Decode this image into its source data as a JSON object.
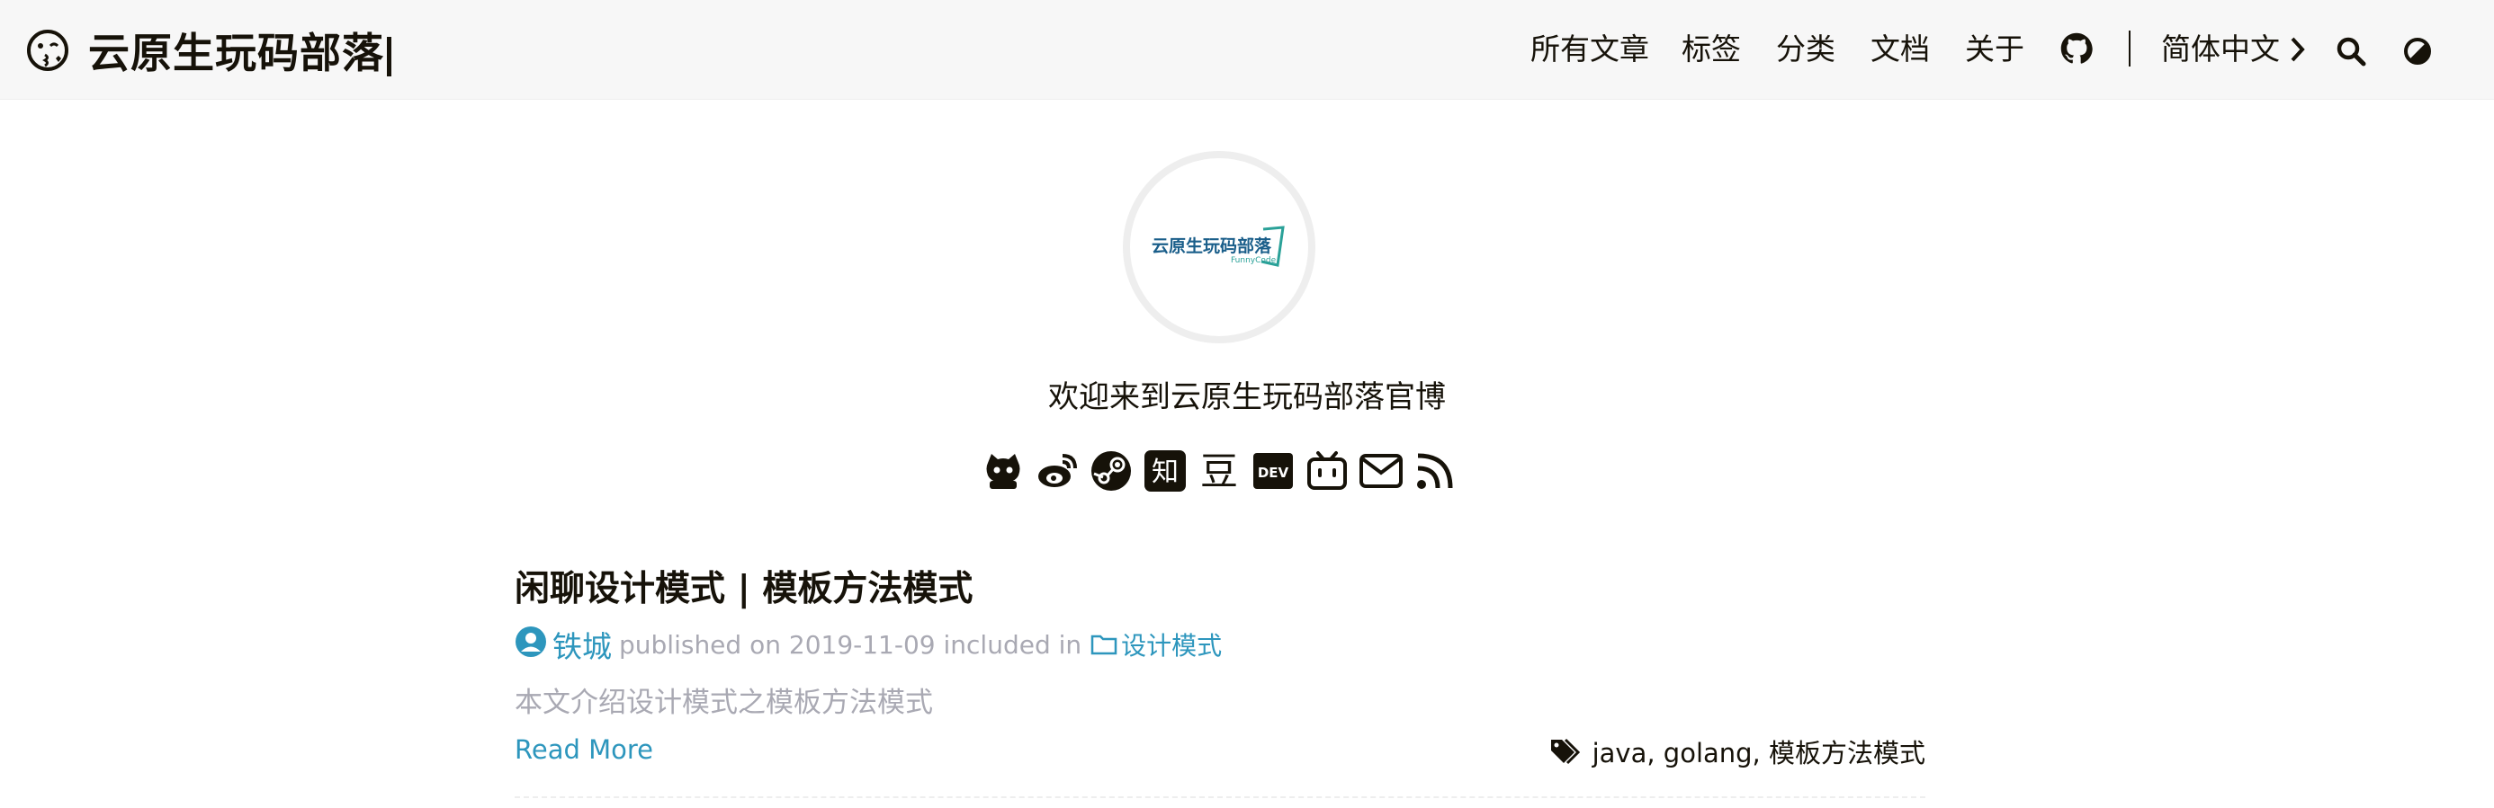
{
  "header": {
    "site_title": "云原生玩码部落",
    "brand_icon": "kiss-wink-face-icon",
    "nav": [
      {
        "label": "所有文章"
      },
      {
        "label": "标签"
      },
      {
        "label": "分类"
      },
      {
        "label": "文档"
      },
      {
        "label": "关于"
      }
    ],
    "github_icon": "github-icon",
    "language": "简体中文",
    "search_icon": "search-icon",
    "theme_icon": "theme-toggle-icon"
  },
  "profile": {
    "avatar_text": "云原生玩码部落",
    "avatar_subtext": "FunnyCode",
    "subtitle": "欢迎来到云原生玩码部落官博",
    "social": [
      "github-icon",
      "weibo-icon",
      "steam-icon",
      "zhihu-icon",
      "douban-icon",
      "dev-icon",
      "bilibili-icon",
      "email-icon",
      "rss-icon"
    ],
    "zhihu_glyph": "知",
    "douban_glyph": "豆",
    "dev_glyph": "DEV"
  },
  "post": {
    "title": "闲聊设计模式 | 模板方法模式",
    "author": "铁城",
    "published_prefix": "published on",
    "date": "2019-11-09",
    "included_in": "included in",
    "category": "设计模式",
    "summary": "本文介绍设计模式之模板方法模式",
    "read_more": "Read More",
    "tags": "java, golang, 模板方法模式"
  },
  "colors": {
    "link": "#2d96bd",
    "muted": "#a9a9b3",
    "text": "#161209",
    "header_bg": "#f7f7f7"
  }
}
